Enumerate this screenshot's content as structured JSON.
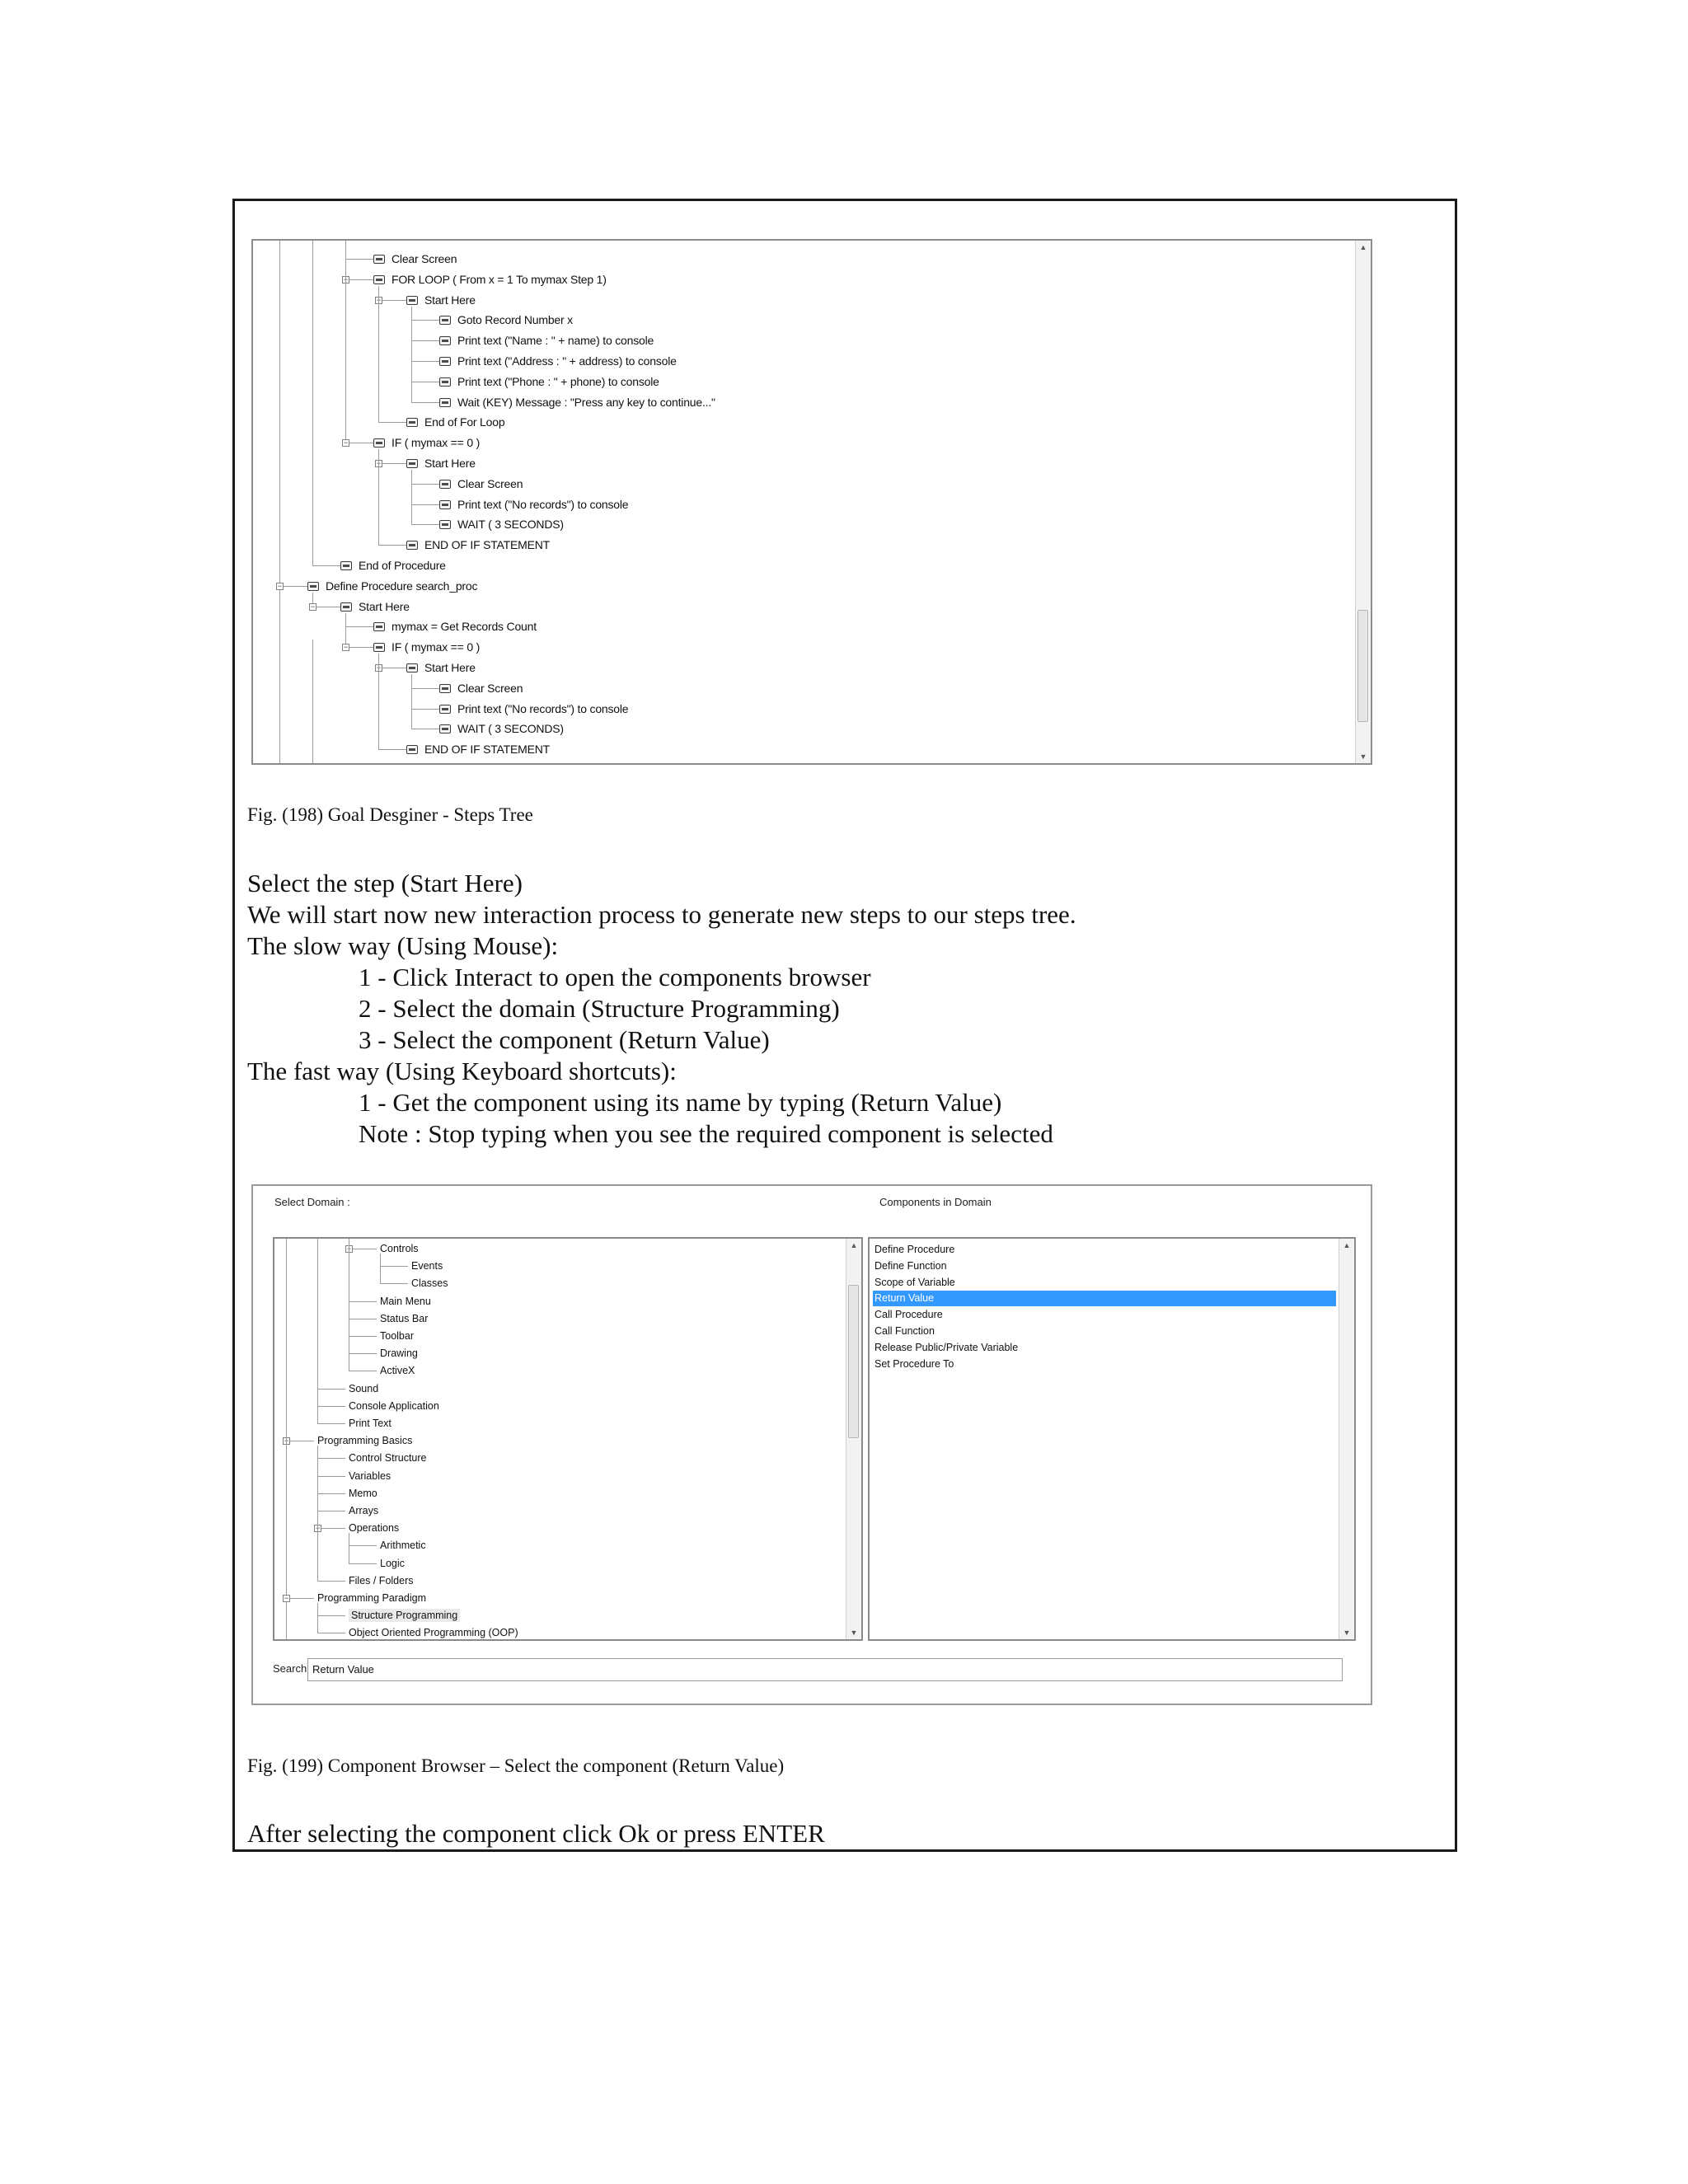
{
  "steps_tree": {
    "nodes": [
      {
        "label": "Clear Screen",
        "level": 3,
        "expander": false
      },
      {
        "label": "FOR LOOP ( From x = 1 To mymax Step 1)",
        "level": 3,
        "expander": true
      },
      {
        "label": "Start Here",
        "level": 4,
        "expander": true
      },
      {
        "label": "Goto Record Number x",
        "level": 5,
        "expander": false
      },
      {
        "label": "Print text (\"Name : \" + name) to console",
        "level": 5,
        "expander": false
      },
      {
        "label": "Print text (\"Address : \" + address) to console",
        "level": 5,
        "expander": false
      },
      {
        "label": "Print text (\"Phone : \" + phone) to console",
        "level": 5,
        "expander": false
      },
      {
        "label": "Wait (KEY) Message : \"Press any key to continue...\"",
        "level": 5,
        "expander": false
      },
      {
        "label": "End of For Loop",
        "level": 4,
        "expander": false
      },
      {
        "label": "IF ( mymax == 0 )",
        "level": 3,
        "expander": true
      },
      {
        "label": "Start Here",
        "level": 4,
        "expander": true
      },
      {
        "label": "Clear Screen",
        "level": 5,
        "expander": false
      },
      {
        "label": "Print text (\"No records\") to console",
        "level": 5,
        "expander": false
      },
      {
        "label": "WAIT ( 3 SECONDS)",
        "level": 5,
        "expander": false
      },
      {
        "label": "END OF IF STATEMENT",
        "level": 4,
        "expander": false
      },
      {
        "label": "End of Procedure",
        "level": 2,
        "expander": false
      },
      {
        "label": "Define Procedure search_proc",
        "level": 1,
        "expander": true
      },
      {
        "label": "Start Here",
        "level": 2,
        "expander": true
      },
      {
        "label": "mymax = Get Records Count",
        "level": 3,
        "expander": false
      },
      {
        "label": "IF ( mymax == 0 )",
        "level": 3,
        "expander": true
      },
      {
        "label": "Start Here",
        "level": 4,
        "expander": true
      },
      {
        "label": "Clear Screen",
        "level": 5,
        "expander": false
      },
      {
        "label": "Print text (\"No records\") to console",
        "level": 5,
        "expander": false
      },
      {
        "label": "WAIT ( 3 SECONDS)",
        "level": 5,
        "expander": false
      },
      {
        "label": "END OF IF STATEMENT",
        "level": 4,
        "expander": false
      }
    ]
  },
  "captions": {
    "fig198": "Fig. (198) Goal Desginer - Steps Tree",
    "fig199": "Fig. (199) Component Browser – Select the component (Return Value)"
  },
  "instructions": {
    "line1": "Select the step (Start Here)",
    "line2": "We will start now new interaction process to generate new steps to our steps tree.",
    "line3": "The slow way (Using Mouse):",
    "step1": "1 - Click Interact to open the components browser",
    "step2": "2 - Select the domain (Structure Programming)",
    "step3": "3 - Select the component (Return Value)",
    "line4": "The fast way (Using Keyboard shortcuts):",
    "fast1": "1 - Get the component using its name by typing (Return Value)",
    "note": "Note : Stop typing when you see the required component is selected",
    "final": "After selecting the component click Ok or press ENTER"
  },
  "browser": {
    "select_domain_label": "Select Domain :",
    "components_label": "Components in Domain",
    "search_label": "Search",
    "search_value": "Return Value",
    "domains": [
      {
        "label": "Controls",
        "level": 3,
        "expander": true
      },
      {
        "label": "Events",
        "level": 4,
        "expander": false
      },
      {
        "label": "Classes",
        "level": 4,
        "expander": false
      },
      {
        "label": "Main Menu",
        "level": 3,
        "expander": false
      },
      {
        "label": "Status Bar",
        "level": 3,
        "expander": false
      },
      {
        "label": "Toolbar",
        "level": 3,
        "expander": false
      },
      {
        "label": "Drawing",
        "level": 3,
        "expander": false
      },
      {
        "label": "ActiveX",
        "level": 3,
        "expander": false
      },
      {
        "label": "Sound",
        "level": 2,
        "expander": false
      },
      {
        "label": "Console Application",
        "level": 2,
        "expander": false
      },
      {
        "label": "Print Text",
        "level": 2,
        "expander": false
      },
      {
        "label": "Programming Basics",
        "level": 1,
        "expander": true
      },
      {
        "label": "Control Structure",
        "level": 2,
        "expander": false
      },
      {
        "label": "Variables",
        "level": 2,
        "expander": false
      },
      {
        "label": "Memo",
        "level": 2,
        "expander": false
      },
      {
        "label": "Arrays",
        "level": 2,
        "expander": false
      },
      {
        "label": "Operations",
        "level": 2,
        "expander": true
      },
      {
        "label": "Arithmetic",
        "level": 3,
        "expander": false
      },
      {
        "label": "Logic",
        "level": 3,
        "expander": false
      },
      {
        "label": "Files / Folders",
        "level": 2,
        "expander": false
      },
      {
        "label": "Programming Paradigm",
        "level": 1,
        "expander": true
      },
      {
        "label": "Structure Programming",
        "level": 2,
        "expander": false,
        "highlighted": true
      },
      {
        "label": "Object Oriented Programming (OOP)",
        "level": 2,
        "expander": false
      }
    ],
    "components": [
      {
        "label": "Define Procedure",
        "selected": false
      },
      {
        "label": "Define Function",
        "selected": false
      },
      {
        "label": "Scope of Variable",
        "selected": false
      },
      {
        "label": "Return Value",
        "selected": true
      },
      {
        "label": "Call Procedure",
        "selected": false
      },
      {
        "label": "Call Function",
        "selected": false
      },
      {
        "label": "Release Public/Private Variable",
        "selected": false
      },
      {
        "label": "Set Procedure To",
        "selected": false
      }
    ],
    "selection_color": "#3399ff"
  }
}
